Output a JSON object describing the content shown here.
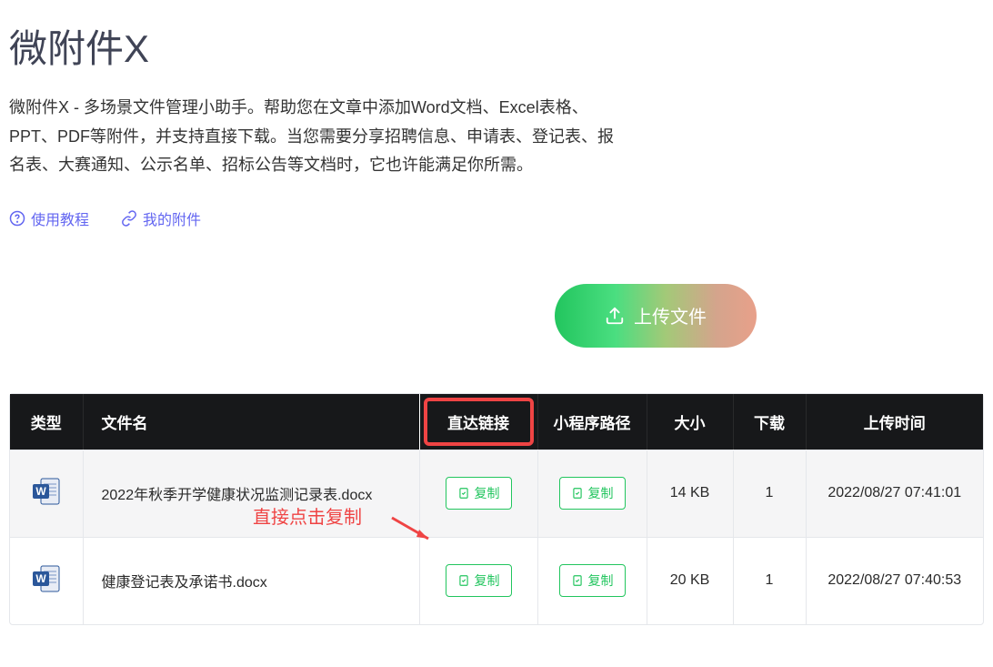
{
  "header": {
    "title": "微附件X",
    "description": "微附件X - 多场景文件管理小助手。帮助您在文章中添加Word文档、Excel表格、PPT、PDF等附件，并支持直接下载。当您需要分享招聘信息、申请表、登记表、报名表、大赛通知、公示名单、招标公告等文档时，它也许能满足你所需。"
  },
  "links": {
    "tutorial": "使用教程",
    "my_attachments": "我的附件"
  },
  "upload_button": "上传文件",
  "annotation": {
    "text": "直接点击复制"
  },
  "table": {
    "headers": {
      "type": "类型",
      "name": "文件名",
      "direct_link": "直达链接",
      "mini_program_path": "小程序路径",
      "size": "大小",
      "downloads": "下载",
      "upload_time": "上传时间"
    },
    "copy_label": "复制",
    "rows": [
      {
        "name": "2022年秋季开学健康状况监测记录表.docx",
        "size": "14 KB",
        "downloads": "1",
        "upload_time": "2022/08/27 07:41:01"
      },
      {
        "name": "健康登记表及承诺书.docx",
        "size": "20 KB",
        "downloads": "1",
        "upload_time": "2022/08/27 07:40:53"
      }
    ]
  }
}
